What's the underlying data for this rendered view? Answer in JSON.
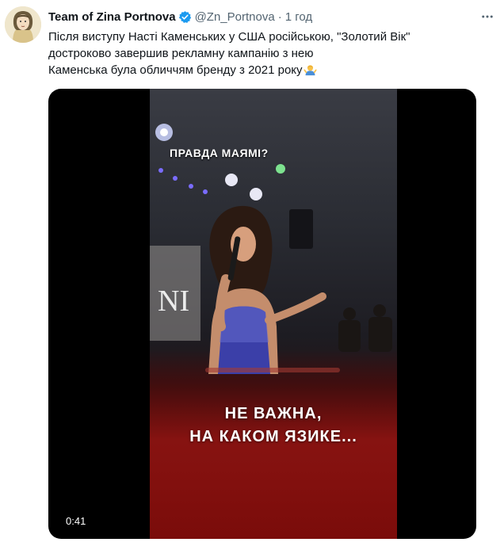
{
  "tweet": {
    "author_name": "Team of Zina Portnova",
    "handle": "@Zn_Portnova",
    "separator": "·",
    "time": "1 год",
    "text_lines": [
      "Після виступу Насті Каменських у США російською, \"Золотий Вік\"",
      "достроково завершив рекламну кампанію з нею",
      "Каменська була обличчям бренду з 2021 року"
    ]
  },
  "video": {
    "subtitle_top": "ПРАВДА МАЯМІ?",
    "subtitle_bottom_line1": "НЕ ВАЖНА,",
    "subtitle_bottom_line2": "НА КАКОМ ЯЗИКЕ...",
    "duration": "0:41"
  },
  "icons": {
    "verified": "verified-badge-icon",
    "more": "more-options-icon",
    "emoji": "man-shrugging-emoji"
  },
  "colors": {
    "verified_blue": "#1d9bf0",
    "secondary_text": "#536471"
  }
}
